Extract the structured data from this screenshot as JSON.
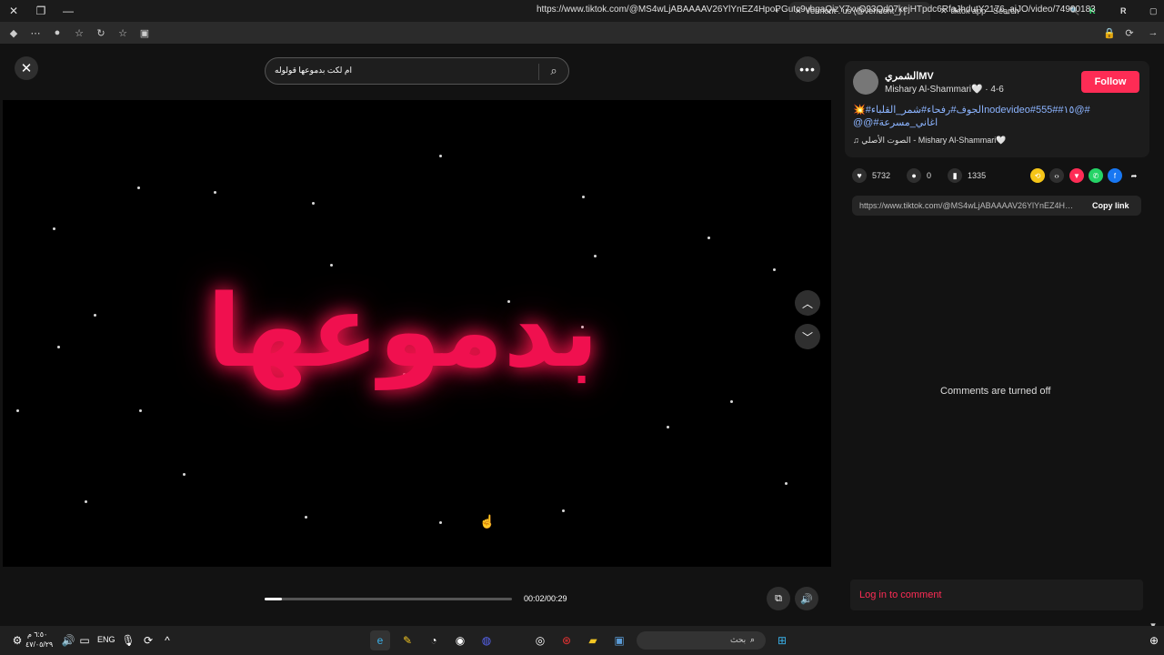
{
  "browser": {
    "tabs": [
      {
        "title": "Vermont . us (@vermont_) | TikTok",
        "active": true
      },
      {
        "title": "tiktok app - Search",
        "active": false
      }
    ],
    "new_tab": "+",
    "url": "https://www.tiktok.com/@MS4wLjABAAAAV26YlYnEZ4HpoPGutc9vhgaQizY7xvO93Qd07kejHTpdc6RfaJhdutY2176_ajJO/video/7490018360445488392"
  },
  "player": {
    "search_text": "ام لكت بدموعها قولوله",
    "video_text": "بدموعها",
    "time": "00:02/00:29",
    "progress": 0.07
  },
  "sidebar": {
    "username": "الشمريMV",
    "nickname": "Mishary Al-Shammari🤍",
    "date": " · 4-6",
    "follow_label": "Follow",
    "description": "#@١٥#nodevideo#555#الجوف#رفحاء#شمر_القلباء#💥 اغاني_مسرعة#@@",
    "music": "♫ الصوت الأصلي - Mishary Al-Shammari🤍",
    "likes": "5732",
    "comments": "0",
    "saves": "1335",
    "link": "https://www.tiktok.com/@MS4wLjABAAAAV26YlYnEZ4HpoPGutc9vhgaQizY7xvO93Qd07kejHTpdc6RfaJhdutY2176_ajJO/video/7490018360445488392",
    "copy_label": "Copy link",
    "comments_off": "Comments are turned off",
    "login_label": "Log in to comment"
  },
  "taskbar": {
    "clock_time": "٦:٥٠ م",
    "clock_date": "٤٧/٠٥/٢٩",
    "lang": "ENG",
    "search_placeholder": "بحث"
  }
}
